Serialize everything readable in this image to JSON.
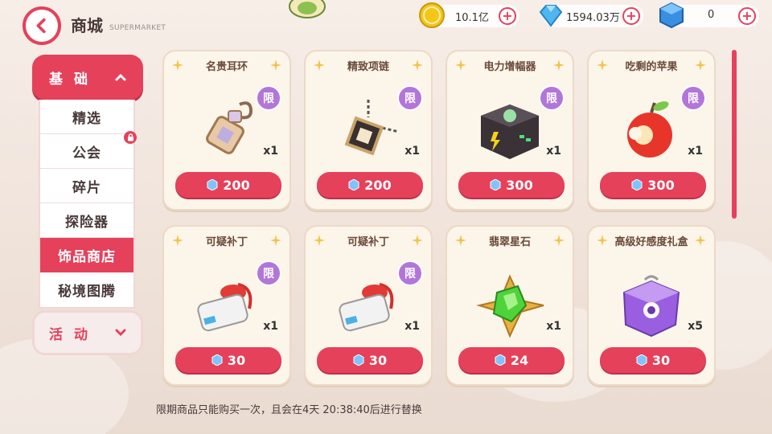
{
  "header": {
    "title": "商城",
    "subtitle": "SUPERMARKET"
  },
  "currencies": [
    {
      "icon": "gold-coin-icon",
      "value": "10.1亿"
    },
    {
      "icon": "diamond-icon",
      "value": "1594.03万"
    },
    {
      "icon": "blue-cube-icon",
      "value": "0"
    }
  ],
  "sidebar": {
    "category_active": "基 础",
    "category_inactive": "活 动",
    "items": [
      {
        "label": "精选",
        "active": false,
        "locked": false
      },
      {
        "label": "公会",
        "active": false,
        "locked": true
      },
      {
        "label": "碎片",
        "active": false,
        "locked": false
      },
      {
        "label": "探险器",
        "active": false,
        "locked": false
      },
      {
        "label": "饰品商店",
        "active": true,
        "locked": false
      },
      {
        "label": "秘境图腾",
        "active": false,
        "locked": false
      }
    ]
  },
  "limit_label": "限",
  "items": [
    {
      "name": "名贵耳环",
      "qty": "x1",
      "price": "200",
      "limited": true,
      "icon": "earring-icon"
    },
    {
      "name": "精致项链",
      "qty": "x1",
      "price": "200",
      "limited": true,
      "icon": "necklace-icon"
    },
    {
      "name": "电力增幅器",
      "qty": "x1",
      "price": "300",
      "limited": true,
      "icon": "power-amplifier-icon"
    },
    {
      "name": "吃剩的苹果",
      "qty": "x1",
      "price": "300",
      "limited": true,
      "icon": "bitten-apple-icon"
    },
    {
      "name": "可疑补丁",
      "qty": "x1",
      "price": "30",
      "limited": true,
      "icon": "patch-icon"
    },
    {
      "name": "可疑补丁",
      "qty": "x1",
      "price": "30",
      "limited": true,
      "icon": "patch-icon"
    },
    {
      "name": "翡翠星石",
      "qty": "x1",
      "price": "24",
      "limited": false,
      "icon": "emerald-star-icon"
    },
    {
      "name": "高级好感度礼盒",
      "qty": "x5",
      "price": "30",
      "limited": false,
      "icon": "gift-box-icon"
    }
  ],
  "notice": "限期商品只能购买一次，且会在4天 20:38:40后进行替换",
  "colors": {
    "accent": "#e5415b",
    "limit_badge": "#b276d9",
    "card_bg": "#fbf5ea"
  }
}
